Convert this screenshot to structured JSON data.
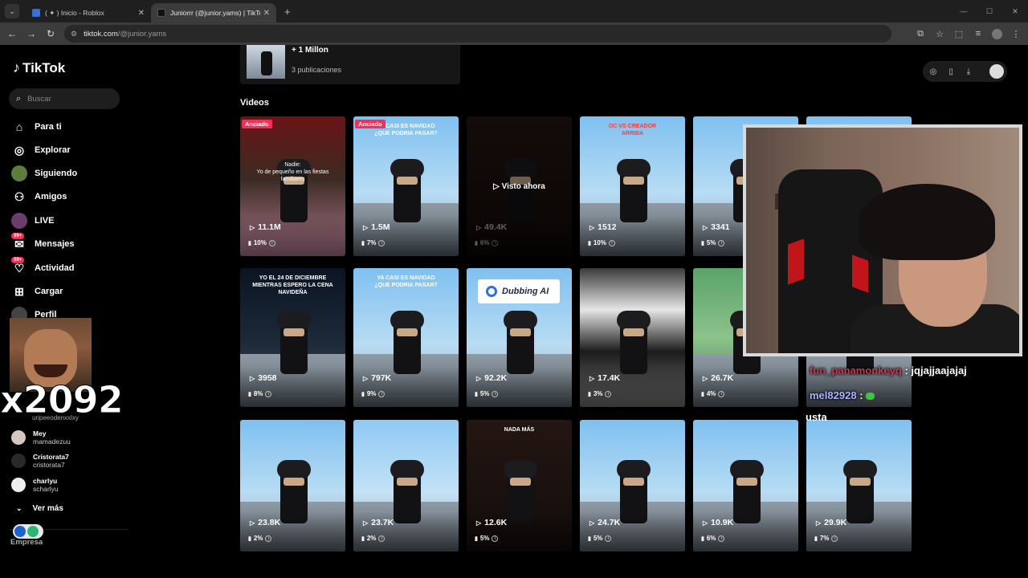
{
  "browser": {
    "tabs": [
      {
        "label": "( ✦ ) Inicio - Roblox",
        "active": false
      },
      {
        "label": "Juniorrr (@junior.yams) | TikTok",
        "active": true
      }
    ],
    "url_host": "tiktok.com",
    "url_path": "/@junior.yams"
  },
  "sidebar": {
    "brand": "TikTok",
    "search_placeholder": "Buscar",
    "items": [
      {
        "label": "Para ti",
        "icon": "home-icon"
      },
      {
        "label": "Explorar",
        "icon": "compass-icon"
      },
      {
        "label": "Siguiendo",
        "icon": "following-avatar-icon"
      },
      {
        "label": "Amigos",
        "icon": "friends-icon"
      },
      {
        "label": "LIVE",
        "icon": "live-avatar-icon"
      },
      {
        "label": "Mensajes",
        "icon": "messages-icon",
        "badge": "99+"
      },
      {
        "label": "Actividad",
        "icon": "activity-icon",
        "badge": "99+"
      },
      {
        "label": "Cargar",
        "icon": "upload-icon"
      },
      {
        "label": "Perfil",
        "icon": "profile-avatar-icon"
      }
    ],
    "following": [
      {
        "name": "Mey",
        "handle": "mamadezuu"
      },
      {
        "name": "Cristorata7",
        "handle": "cristorata7"
      },
      {
        "name": "charlyu",
        "handle": "scharlyu"
      }
    ],
    "partial_handle": "uripeeodenxxlxy",
    "see_more": "Ver más",
    "business": "Empresa"
  },
  "overlay": {
    "combo": "x2092",
    "chat": [
      {
        "user": "fun_panamonkeyq",
        "message": ": jqjajjaajajaj"
      },
      {
        "user": "mel82928",
        "message": ":"
      }
    ],
    "chat_tail": "usta"
  },
  "profile_card": {
    "title": "+ 1 Millon",
    "subtitle": "3 publicaciones"
  },
  "section_title": "Videos",
  "videos": [
    {
      "views": "11.1M",
      "pct": "10%",
      "pinned": "Anciado",
      "caption": "Nadie:\nYo de pequeño en las fiestas familiares",
      "scene": "party"
    },
    {
      "views": "1.5M",
      "pct": "7%",
      "pinned": "Anciado",
      "caption": "YA CASI ES NAVIDAD\n¿QUE PODRIA PASAR?",
      "scene": "sky"
    },
    {
      "views": "49.4K",
      "pct": "6%",
      "watched": "Visto ahora",
      "caption": "",
      "scene": "dark"
    },
    {
      "views": "1512",
      "pct": "10%",
      "caption": "OC VS CREADOR\nARRIBA",
      "caption_red": true,
      "scene": "sky"
    },
    {
      "views": "3341",
      "pct": "5%",
      "caption": "",
      "scene": "sky"
    },
    {
      "views": "",
      "pct": "",
      "caption": "",
      "scene": "sky"
    },
    {
      "views": "3958",
      "pct": "8%",
      "caption": "YO EL 24 DE DICIEMBRE MIENTRAS ESPERO LA CENA NAVIDEÑA",
      "scene": "night"
    },
    {
      "views": "797K",
      "pct": "9%",
      "caption": "YA CASI ES NAVIDAD\n¿QUE PODRIA PASAR?",
      "scene": "sky"
    },
    {
      "views": "92.2K",
      "pct": "5%",
      "dubbing": "Dubbing AI",
      "caption": "",
      "scene": "sky"
    },
    {
      "views": "17.4K",
      "pct": "3%",
      "caption": "",
      "scene": "bed"
    },
    {
      "views": "26.7K",
      "pct": "4%",
      "caption": "",
      "scene": "green"
    },
    {
      "views": "",
      "pct": "",
      "caption": "",
      "scene": "sky"
    },
    {
      "views": "23.8K",
      "pct": "2%",
      "caption": "",
      "scene": "sky"
    },
    {
      "views": "23.7K",
      "pct": "2%",
      "caption": "",
      "scene": "police"
    },
    {
      "views": "12.6K",
      "pct": "5%",
      "caption": "NADA MÁS",
      "scene": "dark"
    },
    {
      "views": "24.7K",
      "pct": "5%",
      "caption": "",
      "scene": "sky"
    },
    {
      "views": "10.9K",
      "pct": "6%",
      "caption": "",
      "scene": "sky"
    },
    {
      "views": "29.9K",
      "pct": "7%",
      "caption": "",
      "scene": "sky"
    }
  ],
  "colors": {
    "accent": "#fe2c55",
    "background": "#000000"
  }
}
